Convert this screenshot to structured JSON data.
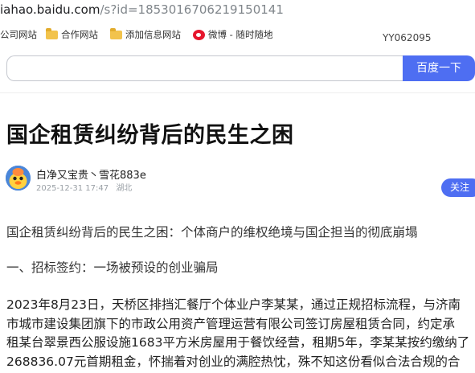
{
  "browser": {
    "url_host": "iahao.baidu.com",
    "url_path": "/s?id=1853016706219150141"
  },
  "bookmarks": [
    {
      "label": "公司网站",
      "icon": "none"
    },
    {
      "label": "合作网站",
      "icon": "folder-icon"
    },
    {
      "label": "添加信息网站",
      "icon": "folder-icon"
    },
    {
      "label": "微博 - 随时随地",
      "icon": "weibo-icon"
    }
  ],
  "watermark": "YY062095",
  "search": {
    "value": "",
    "button_label": "百度一下"
  },
  "article": {
    "title": "国企租赁纠纷背后的民生之困",
    "author": "白净又宝贵丶雪花883e",
    "date": "2025-12-31 17:47",
    "location": "湖北",
    "follow_label": "关注",
    "intro": "国企租赁纠纷背后的民生之困：个体商户的维权绝境与国企担当的彻底崩塌",
    "section1": "一、招标签约：一场被预设的创业骗局",
    "body_lines": [
      "2023年8月23日，天桥区排挡汇餐厅个体业户李某某，通过正规招标流程，与济南",
      "市城市建设集团旗下的市政公用资产管理运营有限公司签订房屋租赁合同，约定承",
      "租某台翠景西公服设施1683平方米房屋用于餐饮经营，租期5年，李某某按约缴纳了",
      "268836.07元首期租金，怀揣着对创业的满腔热忱，殊不知这份看似合法合规的合"
    ]
  }
}
